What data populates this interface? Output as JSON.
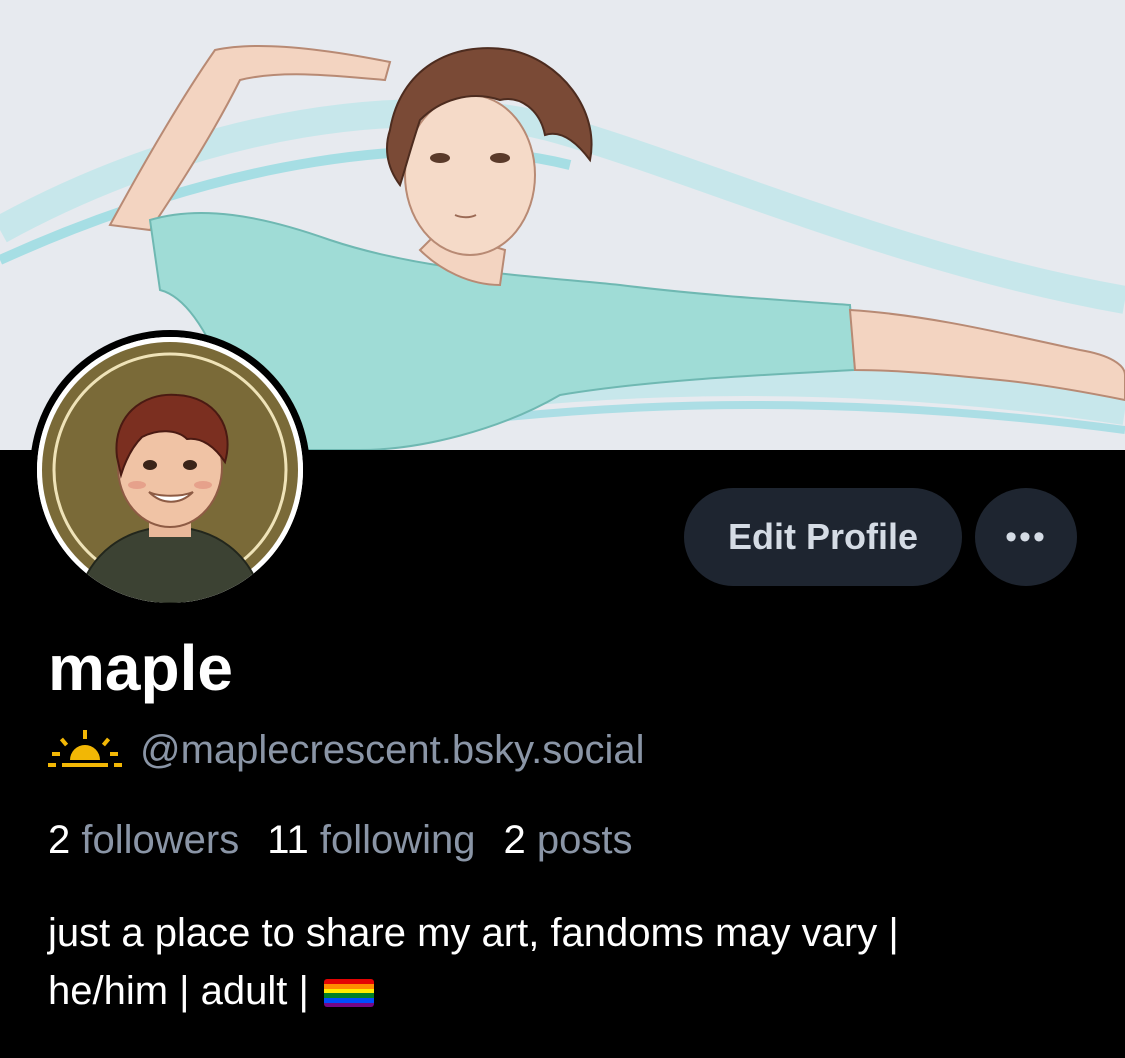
{
  "profile": {
    "display_name": "maple",
    "handle": "@maplecrescent.bsky.social",
    "handle_icon": "sunrise-icon",
    "edit_label": "Edit Profile",
    "more_label": "•••",
    "stats": [
      {
        "count": "2",
        "label": "followers"
      },
      {
        "count": "11",
        "label": "following"
      },
      {
        "count": "2",
        "label": "posts"
      }
    ],
    "bio_line1": "just a place to share my art, fandoms may vary |",
    "bio_line2": "he/him | adult | ",
    "bio_emoji": "rainbow-flag-icon"
  },
  "colors": {
    "background": "#000000",
    "button_bg": "#1e2530",
    "muted_text": "#8a95a6",
    "accent_yellow": "#f2b705"
  }
}
